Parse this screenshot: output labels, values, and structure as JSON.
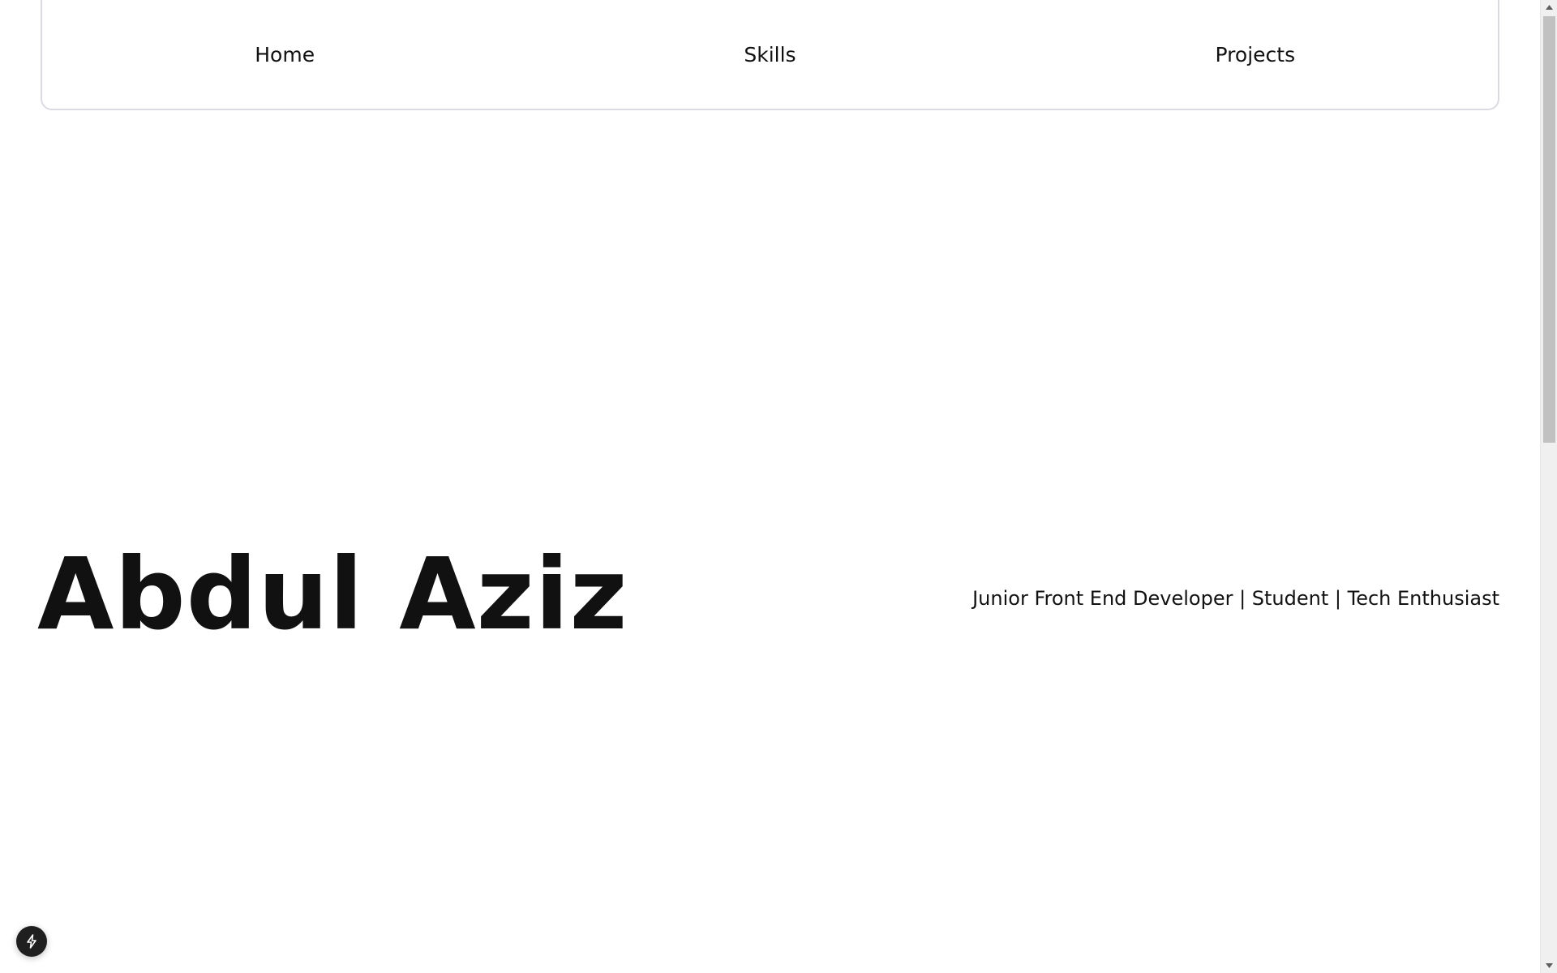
{
  "nav": {
    "items": [
      {
        "label": "Home"
      },
      {
        "label": "Skills"
      },
      {
        "label": "Projects"
      }
    ]
  },
  "hero": {
    "name": "Abdul Aziz",
    "tagline": "Junior Front End Developer | Student | Tech Enthusiast"
  },
  "dev_badge": {
    "icon": "lightning-icon"
  },
  "scrollbar": {
    "thumb_icon_up": "scroll-up-arrow-icon",
    "thumb_icon_down": "scroll-down-arrow-icon"
  },
  "colors": {
    "text": "#111111",
    "nav_border": "#d9dbe0",
    "badge_bg": "#1f1f1f",
    "scroll_thumb": "#c1c1c1",
    "scroll_track": "#f0f0f0"
  }
}
